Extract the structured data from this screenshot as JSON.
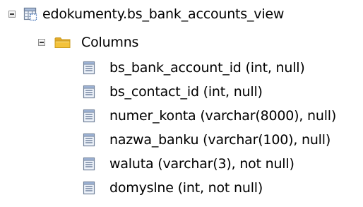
{
  "tree": {
    "view_node": {
      "label": "edokumenty.bs_bank_accounts_view",
      "icon": "view-icon",
      "expanded": true
    },
    "columns_node": {
      "label": "Columns",
      "icon": "folder-icon",
      "expanded": true
    },
    "columns": [
      {
        "label": "bs_bank_account_id (int, null)",
        "icon": "column-icon"
      },
      {
        "label": "bs_contact_id (int, null)",
        "icon": "column-icon"
      },
      {
        "label": "numer_konta (varchar(8000), null)",
        "icon": "column-icon"
      },
      {
        "label": "nazwa_banku (varchar(100), null)",
        "icon": "column-icon"
      },
      {
        "label": "waluta (varchar(3), not null)",
        "icon": "column-icon"
      },
      {
        "label": "domyslne (int, not null)",
        "icon": "column-icon"
      }
    ]
  },
  "colors": {
    "folder": "#f3c23a",
    "folder_dark": "#c99a1d",
    "icon_border": "#6f7f98",
    "icon_fill": "#eef3fa",
    "view_accent": "#4a77b8"
  }
}
